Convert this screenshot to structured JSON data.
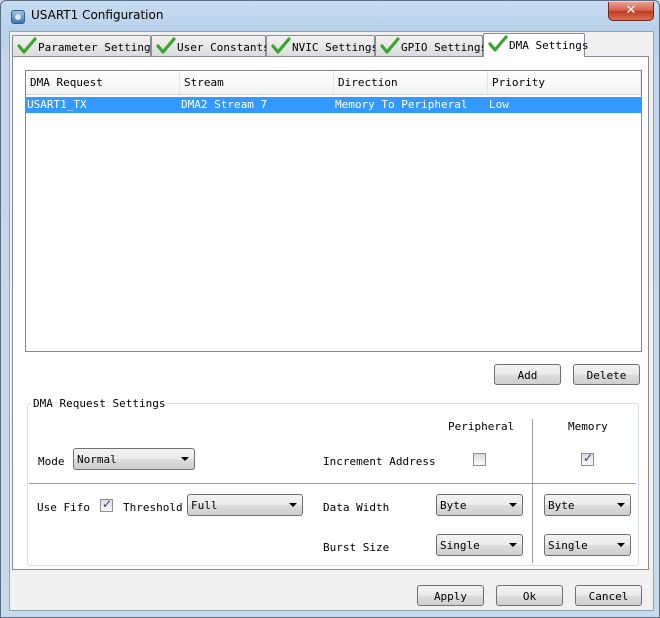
{
  "window": {
    "title": "USART1 Configuration",
    "close_glyph": "✕"
  },
  "tabs": [
    {
      "label": "Parameter Settings",
      "icon": "check-icon"
    },
    {
      "label": "User Constants",
      "icon": "check-icon"
    },
    {
      "label": "NVIC Settings",
      "icon": "check-icon"
    },
    {
      "label": "GPIO Settings",
      "icon": "check-icon"
    },
    {
      "label": "DMA Settings",
      "icon": "check-icon",
      "active": true
    }
  ],
  "dma_table": {
    "columns": [
      "DMA Request",
      "Stream",
      "Direction",
      "Priority"
    ],
    "rows": [
      {
        "request": "USART1_TX",
        "stream": "DMA2 Stream 7",
        "direction": "Memory To Peripheral",
        "priority": "Low",
        "selected": true
      }
    ]
  },
  "buttons": {
    "add": "Add",
    "delete": "Delete",
    "apply": "Apply",
    "ok": "Ok",
    "cancel": "Cancel"
  },
  "request_settings": {
    "title": "DMA Request Settings",
    "peripheral_header": "Peripheral",
    "memory_header": "Memory",
    "mode_label": "Mode",
    "mode_value": "Normal",
    "increment_label": "Increment Address",
    "increment_peripheral_checked": false,
    "increment_memory_checked": true,
    "use_fifo_label": "Use Fifo",
    "use_fifo_checked": true,
    "threshold_label": "Threshold",
    "threshold_value": "Full",
    "data_width_label": "Data Width",
    "data_width_peripheral": "Byte",
    "data_width_memory": "Byte",
    "burst_size_label": "Burst Size",
    "burst_size_peripheral": "Single",
    "burst_size_memory": "Single"
  },
  "colors": {
    "selection": "#3399ff",
    "check_green": "#3aa52e"
  }
}
